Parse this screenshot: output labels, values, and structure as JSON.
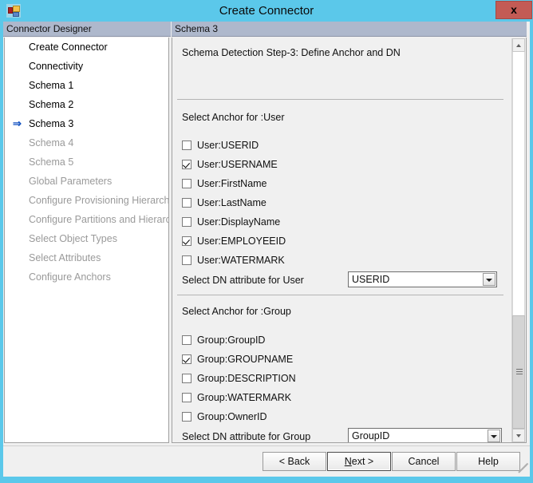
{
  "window": {
    "title": "Create Connector",
    "icon": "connector-app-icon",
    "close_label": "x",
    "accent_color": "#5bc8ea",
    "close_button_color": "#c35b55"
  },
  "left_pane": {
    "header": "Connector Designer",
    "items": [
      {
        "label": "Create Connector",
        "state": "done",
        "current": false
      },
      {
        "label": "Connectivity",
        "state": "done",
        "current": false
      },
      {
        "label": "Schema 1",
        "state": "done",
        "current": false
      },
      {
        "label": "Schema 2",
        "state": "done",
        "current": false
      },
      {
        "label": "Schema 3",
        "state": "done",
        "current": true
      },
      {
        "label": "Schema 4",
        "state": "disabled",
        "current": false
      },
      {
        "label": "Schema 5",
        "state": "disabled",
        "current": false
      },
      {
        "label": "Global Parameters",
        "state": "disabled",
        "current": false
      },
      {
        "label": "Configure Provisioning Hierarchy",
        "state": "disabled",
        "current": false
      },
      {
        "label": "Configure Partitions and Hierarchies",
        "state": "disabled",
        "current": false
      },
      {
        "label": "Select Object Types",
        "state": "disabled",
        "current": false
      },
      {
        "label": "Select Attributes",
        "state": "disabled",
        "current": false
      },
      {
        "label": "Configure Anchors",
        "state": "disabled",
        "current": false
      }
    ],
    "current_marker": "⇒"
  },
  "right_pane": {
    "header": "Schema 3",
    "step_title": "Schema Detection Step-3: Define Anchor and DN",
    "user_section": {
      "label": "Select Anchor for :User",
      "checkboxes": [
        {
          "label": "User:USERID",
          "checked": false
        },
        {
          "label": "User:USERNAME",
          "checked": true
        },
        {
          "label": "User:FirstName",
          "checked": false
        },
        {
          "label": "User:LastName",
          "checked": false
        },
        {
          "label": "User:DisplayName",
          "checked": false
        },
        {
          "label": "User:EMPLOYEEID",
          "checked": true
        },
        {
          "label": "User:WATERMARK",
          "checked": false
        }
      ],
      "dn_label": "Select DN attribute for User",
      "dn_value": "USERID"
    },
    "group_section": {
      "label": "Select Anchor for :Group",
      "checkboxes": [
        {
          "label": "Group:GroupID",
          "checked": false
        },
        {
          "label": "Group:GROUPNAME",
          "checked": true
        },
        {
          "label": "Group:DESCRIPTION",
          "checked": false
        },
        {
          "label": "Group:WATERMARK",
          "checked": false
        },
        {
          "label": "Group:OwnerID",
          "checked": false
        }
      ],
      "dn_label": "Select DN attribute for Group",
      "dn_value": "GroupID"
    },
    "scrollbar": {
      "up_icon": "chevron-up-icon",
      "down_icon": "chevron-down-icon"
    }
  },
  "buttons": {
    "back": "< Back",
    "next_prefix": "N",
    "next_suffix": "ext  >",
    "cancel": "Cancel",
    "help": "Help"
  }
}
